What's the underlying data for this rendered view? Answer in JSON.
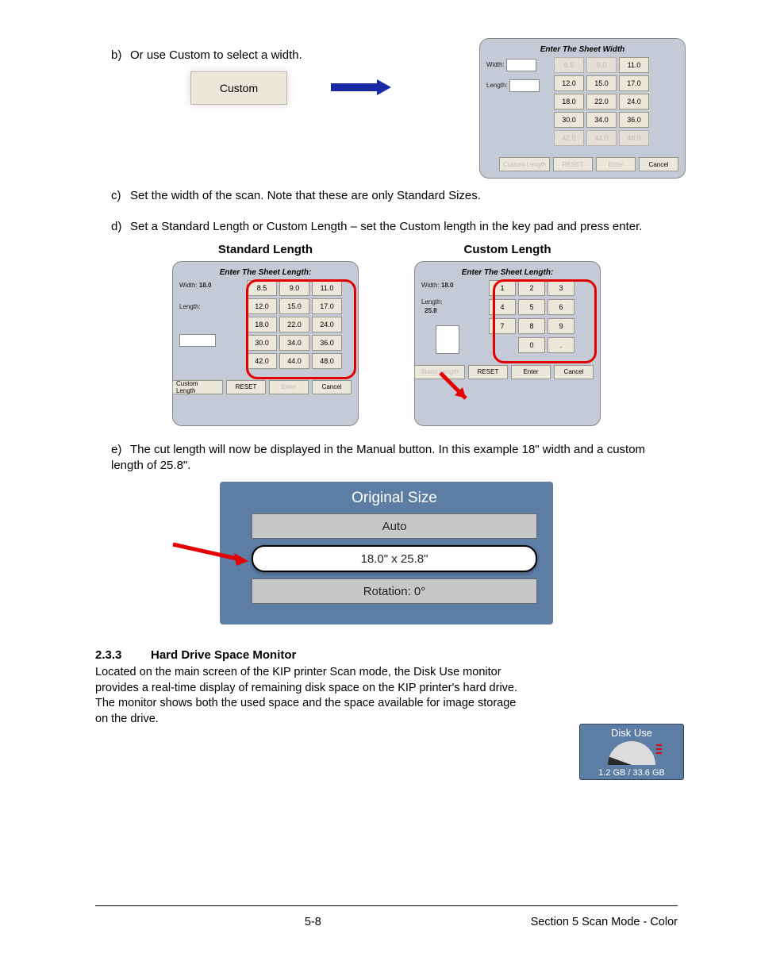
{
  "step_b": {
    "label": "b)",
    "text": "Or use Custom to select a width."
  },
  "custom_button_label": "Custom",
  "width_dialog": {
    "title": "Enter The Sheet Width",
    "width_label": "Width:",
    "length_label": "Length:",
    "grid": [
      {
        "v": "8.5",
        "disabled": true
      },
      {
        "v": "9.0",
        "disabled": true
      },
      {
        "v": "11.0",
        "disabled": false
      },
      {
        "v": "12.0",
        "disabled": false
      },
      {
        "v": "15.0",
        "disabled": false
      },
      {
        "v": "17.0",
        "disabled": false
      },
      {
        "v": "18.0",
        "disabled": false
      },
      {
        "v": "22.0",
        "disabled": false
      },
      {
        "v": "24.0",
        "disabled": false
      },
      {
        "v": "30.0",
        "disabled": false
      },
      {
        "v": "34.0",
        "disabled": false
      },
      {
        "v": "36.0",
        "disabled": false
      },
      {
        "v": "42.0",
        "disabled": true
      },
      {
        "v": "44.0",
        "disabled": true
      },
      {
        "v": "48.0",
        "disabled": true
      }
    ],
    "footer": [
      {
        "label": "Custom Length",
        "disabled": true,
        "wide": true
      },
      {
        "label": "RESET",
        "disabled": true
      },
      {
        "label": "Enter",
        "disabled": true
      },
      {
        "label": "Cancel",
        "disabled": false
      }
    ]
  },
  "step_c": {
    "label": "c)",
    "text": "Set the width of the scan. Note that these are only Standard Sizes."
  },
  "step_d": {
    "label": "d)",
    "text": "Set a Standard Length or Custom Length – set the Custom length in the key pad and press enter."
  },
  "std": {
    "heading": "Standard Length",
    "title": "Enter The Sheet Length:",
    "width_label": "Width:",
    "width_value": "18.0",
    "length_label": "Length:",
    "grid": [
      {
        "v": "8.5"
      },
      {
        "v": "9.0"
      },
      {
        "v": "11.0"
      },
      {
        "v": "12.0"
      },
      {
        "v": "15.0"
      },
      {
        "v": "17.0"
      },
      {
        "v": "18.0"
      },
      {
        "v": "22.0"
      },
      {
        "v": "24.0"
      },
      {
        "v": "30.0"
      },
      {
        "v": "34.0"
      },
      {
        "v": "36.0"
      },
      {
        "v": "42.0"
      },
      {
        "v": "44.0"
      },
      {
        "v": "48.0"
      }
    ],
    "footer": [
      {
        "label": "Custom Length",
        "wide": true
      },
      {
        "label": "RESET"
      },
      {
        "label": "Enter",
        "disabled": true
      },
      {
        "label": "Cancel"
      }
    ]
  },
  "cust": {
    "heading": "Custom Length",
    "title": "Enter The Sheet Length:",
    "width_label": "Width:",
    "width_value": "18.0",
    "length_label": "Length:",
    "length_value": "25.8",
    "grid": [
      {
        "v": "1"
      },
      {
        "v": "2"
      },
      {
        "v": "3"
      },
      {
        "v": "4"
      },
      {
        "v": "5"
      },
      {
        "v": "6"
      },
      {
        "v": "7"
      },
      {
        "v": "8"
      },
      {
        "v": "9"
      },
      {
        "v": ""
      },
      {
        "v": "0"
      },
      {
        "v": "."
      }
    ],
    "footer": [
      {
        "label": "Stand Length",
        "disabled": true,
        "wide": true
      },
      {
        "label": "RESET"
      },
      {
        "label": "Enter"
      },
      {
        "label": "Cancel"
      }
    ]
  },
  "step_e": {
    "label": "e)",
    "text": "The cut length will now be displayed in the Manual button. In this example 18\" width and a custom length of 25.8\"."
  },
  "orig": {
    "title": "Original Size",
    "auto": "Auto",
    "manual": "18.0\" x 25.8\"",
    "rotation": "Rotation: 0°"
  },
  "sect233": {
    "num": "2.3.3",
    "title": "Hard Drive Space Monitor",
    "body": "Located on the main screen of the KIP printer Scan mode, the Disk Use monitor provides a real-time display of remaining disk space on the KIP printer's hard drive. The monitor shows both the used space and the space available for image storage on the drive."
  },
  "diskuse": {
    "title": "Disk Use",
    "text": "1.2 GB / 33.6 GB"
  },
  "footer": {
    "page": "5-8",
    "section": "Section 5    Scan Mode - Color"
  }
}
